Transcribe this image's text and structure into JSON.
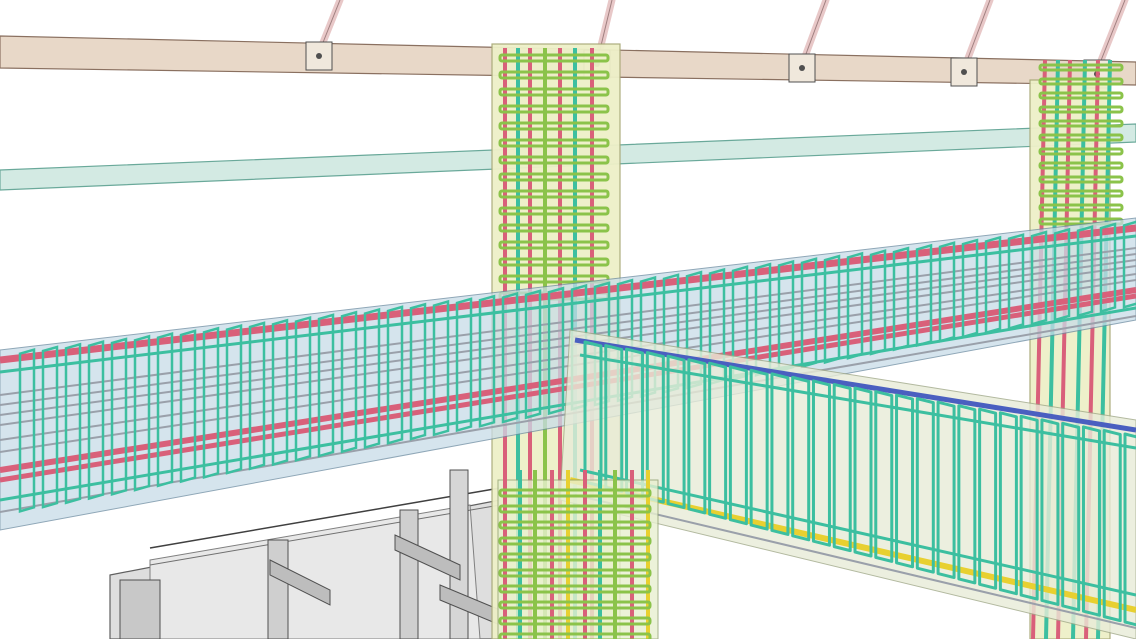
{
  "scene": {
    "subject": "rebar-reinforcement-model-view",
    "colors": {
      "background": "#ffffff",
      "ceiling_beam": "#e8d8c8",
      "ceiling_beam_edge": "#8a7060",
      "hanger_rod": "#e8c8c8",
      "glass_beam": "#cfe8e0",
      "glass_beam_edge": "#5aa090",
      "column_fill": "#eef0c8",
      "column_edge": "#a8a878",
      "stirrup_teal": "#3cbfa0",
      "stirrup_green": "#8bc34a",
      "bar_red": "#d9607a",
      "bar_blue": "#4a5fc0",
      "bar_yellow": "#e8d030",
      "bar_gray": "#9aa0aa",
      "concrete_blue": "#c8dce8",
      "lower_floor": "#dcdcdc",
      "lower_edge": "#606060"
    }
  }
}
